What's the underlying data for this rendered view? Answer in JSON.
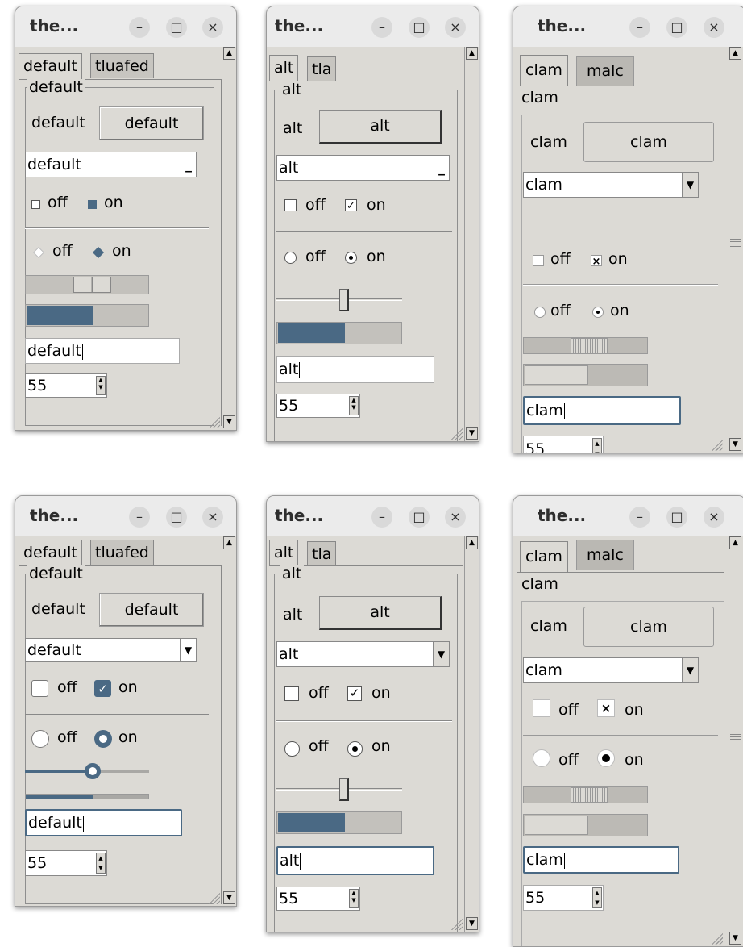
{
  "colors": {
    "accent": "#4a6984",
    "window_bg": "#dcdad5",
    "titlebar_bg": "#ebebeb"
  },
  "titlebar": {
    "title": "the...",
    "min": "–",
    "max": "□",
    "close": "×"
  },
  "default": {
    "tab1": "default",
    "tab2": "tluafed",
    "group": "default",
    "label": "default",
    "button": "default",
    "combo": "default",
    "entry": "default"
  },
  "alt": {
    "tab1": "alt",
    "tab2": "tla",
    "group": "alt",
    "label": "alt",
    "button": "alt",
    "combo": "alt",
    "entry": "alt"
  },
  "clam": {
    "tab1": "clam",
    "tab2": "malc",
    "group": "clam",
    "label": "clam",
    "button": "clam",
    "combo": "clam",
    "entry": "clam"
  },
  "common": {
    "off": "off",
    "on": "on",
    "spin_value": "55",
    "checkmark": "✓",
    "xmark": "×",
    "progress_fraction": 0.55,
    "slider_fraction": 0.55
  }
}
